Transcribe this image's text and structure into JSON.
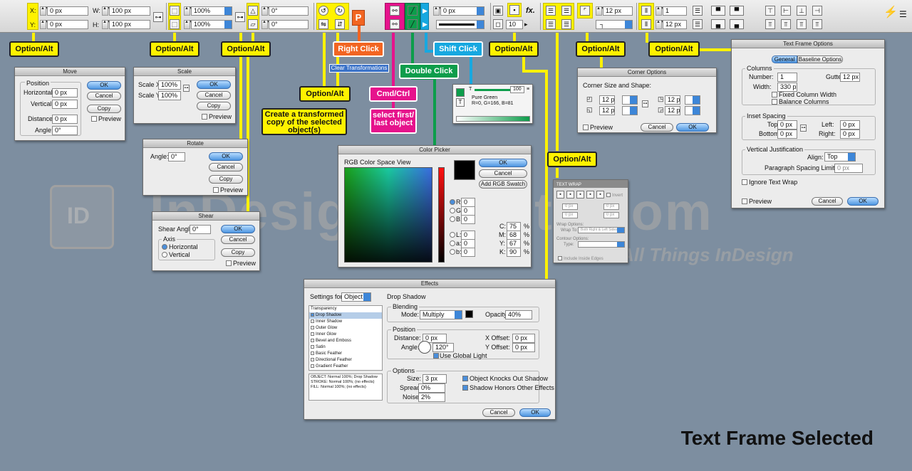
{
  "toolbar": {
    "x_label": "X:",
    "x_value": "0 px",
    "y_label": "Y:",
    "y_value": "0 px",
    "w_label": "W:",
    "w_value": "100 px",
    "h_label": "H:",
    "h_value": "100 px",
    "scale_x": "100%",
    "scale_y": "100%",
    "rotate": "0°",
    "shear": "0°",
    "fx_label": "fx.",
    "stroke_weight": "0 px",
    "opacity": "10",
    "corner_size": "12 px",
    "columns": "1",
    "gutter": "12 px"
  },
  "callouts": {
    "opt1": "Option/Alt",
    "opt2": "Option/Alt",
    "opt3": "Option/Alt",
    "opt4": "Option/Alt",
    "opt5": "Option/Alt",
    "opt6": "Option/Alt",
    "opt7": "Option/Alt",
    "opt8": "Option/Alt",
    "right_click": "Right Click",
    "clear_transform": "Clear Transformations",
    "cmd_ctrl": "Cmd/Ctrl",
    "double_click": "Double Click",
    "shift_click": "Shift Click",
    "transformed_copy": "Create a transformed copy of the selected object(s)",
    "select_first_last": "select first/ last object"
  },
  "move": {
    "title": "Move",
    "position": "Position",
    "horizontal": "Horizontal:",
    "h_val": "0 px",
    "vertical": "Vertical:",
    "v_val": "0 px",
    "distance": "Distance:",
    "d_val": "0 px",
    "angle": "Angle:",
    "a_val": "0°",
    "ok": "OK",
    "cancel": "Cancel",
    "copy": "Copy",
    "preview": "Preview"
  },
  "scale": {
    "title": "Scale",
    "sx": "Scale X:",
    "sx_val": "100%",
    "sy": "Scale Y:",
    "sy_val": "100%",
    "ok": "OK",
    "cancel": "Cancel",
    "copy": "Copy",
    "preview": "Preview"
  },
  "rotate": {
    "title": "Rotate",
    "angle": "Angle:",
    "a_val": "0°",
    "ok": "OK",
    "cancel": "Cancel",
    "copy": "Copy",
    "preview": "Preview"
  },
  "shear": {
    "title": "Shear",
    "angle": "Shear Angle:",
    "a_val": "0°",
    "axis": "Axis",
    "horizontal": "Horizontal",
    "vertical": "Vertical",
    "ok": "OK",
    "cancel": "Cancel",
    "copy": "Copy",
    "preview": "Preview"
  },
  "swatch": {
    "value": "100",
    "name": "Pure Green",
    "rgb": "R=0, G=166, B=81",
    "t": "T"
  },
  "colorpicker": {
    "title": "Color Picker",
    "view": "RGB Color Space View",
    "ok": "OK",
    "cancel": "Cancel",
    "add": "Add RGB Swatch",
    "r": "R:",
    "r_v": "0",
    "g": "G:",
    "g_v": "0",
    "b": "B:",
    "b_v": "0",
    "l": "L:",
    "l_v": "0",
    "a": "a:",
    "a_v": "0",
    "bb": "b:",
    "bb_v": "0",
    "c": "C:",
    "c_v": "75",
    "m": "M:",
    "m_v": "68",
    "y": "Y:",
    "y_v": "67",
    "k": "K:",
    "k_v": "90",
    "pct": "%"
  },
  "corner": {
    "title": "Corner Options",
    "label": "Corner Size and Shape:",
    "v1": "12 px",
    "v2": "12 px",
    "v3": "12 px",
    "v4": "12 px",
    "preview": "Preview",
    "cancel": "Cancel",
    "ok": "OK"
  },
  "wrap": {
    "title": "TEXT WRAP",
    "invert": "Invert",
    "wrap_options": "Wrap Options:",
    "wrap_to": "Wrap To:",
    "wrap_to_val": "Both Right & Left Sides",
    "contour": "Contour Options:",
    "type": "Type:",
    "inside": "Include Inside Edges",
    "v1": "0 px",
    "v2": "0 px",
    "v3": "0 px",
    "v4": "0 px"
  },
  "tfo": {
    "title": "Text Frame Options",
    "tab1": "General",
    "tab2": "Baseline Options",
    "columns": "Columns",
    "number": "Number:",
    "number_v": "1",
    "gutter": "Gutter:",
    "gutter_v": "12 px",
    "width": "Width:",
    "width_v": "330 px",
    "fixed": "Fixed Column Width",
    "balance": "Balance Columns",
    "inset": "Inset Spacing",
    "top": "Top:",
    "top_v": "0 px",
    "bottom": "Bottom:",
    "bottom_v": "0 px",
    "left": "Left:",
    "left_v": "0 px",
    "right": "Right:",
    "right_v": "0 px",
    "vj": "Vertical Justification",
    "align": "Align:",
    "align_v": "Top",
    "psl": "Paragraph Spacing Limit:",
    "psl_v": "0 px",
    "ignore": "Ignore Text Wrap",
    "preview": "Preview",
    "cancel": "Cancel",
    "ok": "OK"
  },
  "effects": {
    "title": "Effects",
    "settings_for": "Settings for:",
    "settings_val": "Object",
    "drop_shadow": "Drop Shadow",
    "list": [
      "Transparency",
      "Drop Shadow",
      "Inner Shadow",
      "Outer Glow",
      "Inner Glow",
      "Bevel and Emboss",
      "Satin",
      "Basic Feather",
      "Directional Feather",
      "Gradient Feather"
    ],
    "summary": "OBJECT: Normal 100%; Drop Shadow\nSTROKE: Normal 100%; (no effects)\nFILL: Normal 100%; (no effects)",
    "blending": "Blending",
    "mode": "Mode:",
    "mode_v": "Multiply",
    "opacity": "Opacity:",
    "opacity_v": "40%",
    "position": "Position",
    "distance": "Distance:",
    "distance_v": "0 px",
    "angle": "Angle:",
    "angle_v": "120°",
    "global": "Use Global Light",
    "xoff": "X Offset:",
    "xoff_v": "0 px",
    "yoff": "Y Offset:",
    "yoff_v": "0 px",
    "options": "Options",
    "size": "Size:",
    "size_v": "3 px",
    "spread": "Spread:",
    "spread_v": "0%",
    "noise": "Noise:",
    "noise_v": "2%",
    "knocks": "Object Knocks Out Shadow",
    "honors": "Shadow Honors Other Effects",
    "cancel": "Cancel",
    "ok": "OK"
  },
  "watermark": {
    "logo": "ID",
    "site": "InDesignSecrets.com",
    "tagline": "for All Things InDesign"
  },
  "footer": {
    "title": "Text Frame Selected"
  },
  "colors": {
    "yellow": "#fff200",
    "orange": "#f26522",
    "magenta": "#e6138c",
    "green": "#0d9d4b",
    "cyan": "#17a8e0",
    "bg": "#7d8ea0"
  }
}
